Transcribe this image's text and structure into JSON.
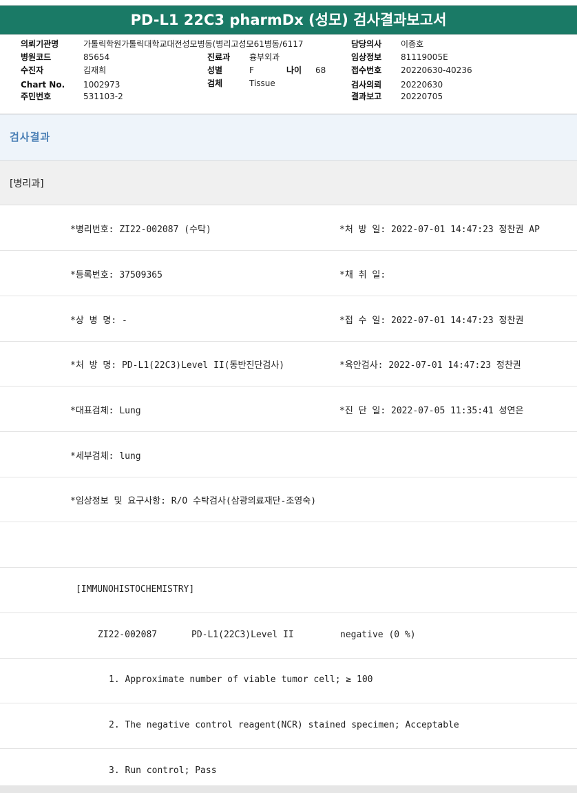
{
  "report_title": "PD-L1 22C3 pharmDx (성모) 검사결과보고서",
  "header": {
    "hospital_label": "의뢰기관명",
    "hospital_value": "가톨릭학원가톨릭대학교대전성모병동(병리고성모61병동/6117",
    "code_label": "병원코드",
    "code_value": "85654",
    "patient_label": "수진자",
    "patient_value": "김재희",
    "chart_label": "Chart No.",
    "chart_value": "1002973",
    "id_label": "주민번호",
    "id_value": "531103-2",
    "dept_label": "진료과",
    "dept_value": "흉부외과",
    "sex_label": "성별",
    "sex_value": "F",
    "age_label": "나이",
    "age_value": "68",
    "specimen_label": "검체",
    "specimen_value": "Tissue",
    "doctor_label": "담당의사",
    "doctor_value": "이종호",
    "clinical_label": "임상정보",
    "clinical_value": "81119005E",
    "receipt_label": "접수번호",
    "receipt_value": "20220630-40236",
    "request_label": "검사의뢰",
    "request_value": "20220630",
    "result_date_label": "결과보고",
    "result_date_value": "20220705"
  },
  "section_title": "검사결과",
  "department": "[병리과]",
  "rows": [
    {
      "left": "*병리번호: ZI22-002087 (수탁)",
      "right": "*처 방 일: 2022-07-01 14:47:23  정찬권 AP"
    },
    {
      "left": "*등록번호: 37509365",
      "right": "*채 취 일:"
    },
    {
      "left": "*상 병 명: -",
      "right": "*접 수 일: 2022-07-01 14:47:23  정찬권"
    },
    {
      "left": "*처 방 명: PD-L1(22C3)Level II(동반진단검사)",
      "right": "*육안검사: 2022-07-01 14:47:23  정찬권"
    },
    {
      "left": "*대표검체: Lung",
      "right": "*진 단 일: 2022-07-05 11:35:41  성연은"
    },
    {
      "left": "*세부검체: lung",
      "right": ""
    },
    {
      "left": "*임상정보 및 요구사항: R/O 수탁검사(삼광의료재단-조영숙)",
      "right": ""
    }
  ],
  "ihc_title": "[IMMUNOHISTOCHEMISTRY]",
  "ihc_result": {
    "specimen": "ZI22-002087",
    "test": "PD-L1(22C3)Level II",
    "result": "negative (0 %)"
  },
  "notes": [
    "1. Approximate number of viable tumor cell; ≥ 100",
    "2. The negative control reagent(NCR) stained specimen; Acceptable",
    "3. Run control; Pass"
  ]
}
